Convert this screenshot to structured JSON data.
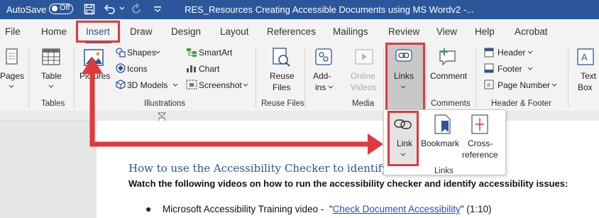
{
  "titlebar": {
    "autosave_label": "AutoSave",
    "autosave_state": "Off",
    "document_title": "RES_Resources Creating Accessible Documents using MS Wordv2  -..."
  },
  "tabs": [
    {
      "label": "File"
    },
    {
      "label": "Home"
    },
    {
      "label": "Insert",
      "active": true
    },
    {
      "label": "Draw"
    },
    {
      "label": "Design"
    },
    {
      "label": "Layout"
    },
    {
      "label": "References"
    },
    {
      "label": "Mailings"
    },
    {
      "label": "Review"
    },
    {
      "label": "View"
    },
    {
      "label": "Help"
    },
    {
      "label": "Acrobat"
    }
  ],
  "ribbon": {
    "pages": {
      "label": "Pages"
    },
    "tables": {
      "table_label": "Table",
      "group": "Tables"
    },
    "illustrations": {
      "pictures": "Pictures",
      "shapes": "Shapes",
      "icons": "Icons",
      "models3d": "3D Models",
      "smartart": "SmartArt",
      "chart": "Chart",
      "screenshot": "Screenshot",
      "group": "Illustrations"
    },
    "reuse": {
      "line1": "Reuse",
      "line2": "Files",
      "group": "Reuse Files"
    },
    "addins": {
      "line1": "Add-",
      "line2": "ins"
    },
    "media": {
      "line1": "Online",
      "line2": "Videos",
      "group": "Media"
    },
    "links": {
      "label": "Links"
    },
    "comments": {
      "label": "Comment",
      "group": "Comments"
    },
    "header_footer": {
      "header": "Header",
      "footer": "Footer",
      "page_number": "Page Number",
      "group": "Header & Footer"
    },
    "text": {
      "line1": "Text",
      "line2": "Box"
    }
  },
  "dropdown": {
    "link": "Link",
    "bookmark": "Bookmark",
    "cross1": "Cross-",
    "cross2": "reference",
    "group": "Links"
  },
  "document": {
    "heading": "How to use the Accessibility Checker to identify a",
    "heading_tail": "ues",
    "instruction": "Watch the following videos on how to run the accessibility checker and identify accessibility issues:",
    "bullet_prefix": "Microsoft Accessibility Training video -  \"",
    "bullet_link": "Check Document Accessibility",
    "bullet_suffix": "\" (1:10)"
  },
  "colors": {
    "titlebar": "#2b579a",
    "annotation_red": "#e0393b",
    "hyperlink": "#1f4fc1"
  }
}
